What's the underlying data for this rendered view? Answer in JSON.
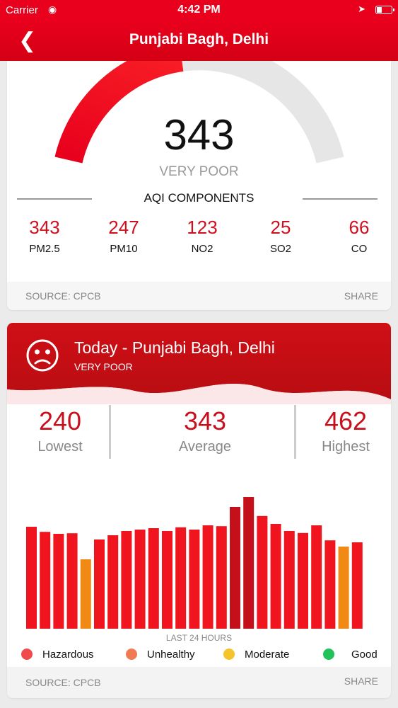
{
  "status_bar": {
    "carrier": "Carrier",
    "time": "4:42 PM"
  },
  "nav": {
    "title": "Punjabi Bagh, Delhi",
    "back_icon": "chevron-left-icon"
  },
  "aqi": {
    "value": "343",
    "status": "VERY POOR",
    "gauge_fill": 0.45
  },
  "components": {
    "title": "AQI COMPONENTS",
    "items": [
      {
        "value": "343",
        "name": "PM2.5"
      },
      {
        "value": "247",
        "name": "PM10"
      },
      {
        "value": "123",
        "name": "NO2"
      },
      {
        "value": "25",
        "name": "SO2"
      },
      {
        "value": "66",
        "name": "CO"
      }
    ]
  },
  "card1_footer": {
    "source": "SOURCE: CPCB",
    "share": "SHARE"
  },
  "today": {
    "title": "Today - Punjabi Bagh, Delhi",
    "status": "VERY POOR",
    "icon": "sad-face-icon",
    "lowest": {
      "value": "240",
      "label": "Lowest"
    },
    "average": {
      "value": "343",
      "label": "Average"
    },
    "highest": {
      "value": "462",
      "label": "Highest"
    }
  },
  "chart_data": {
    "type": "bar",
    "caption": "LAST 24 HOURS",
    "values": [
      360,
      342,
      335,
      337,
      245,
      315,
      330,
      345,
      350,
      355,
      345,
      358,
      350,
      365,
      362,
      430,
      465,
      398,
      370,
      345,
      338,
      365,
      312,
      290,
      305
    ],
    "colors": [
      "#f0141e",
      "#f0141e",
      "#f0141e",
      "#f0141e",
      "#f08a14",
      "#f0141e",
      "#f0141e",
      "#f0141e",
      "#f0141e",
      "#f0141e",
      "#f0141e",
      "#f0141e",
      "#f0141e",
      "#f0141e",
      "#f0141e",
      "#c4101a",
      "#c4101a",
      "#f0141e",
      "#f0141e",
      "#f0141e",
      "#f0141e",
      "#f0141e",
      "#f0141e",
      "#f08a14",
      "#f0141e"
    ],
    "ylim": [
      0,
      470
    ]
  },
  "legend": [
    {
      "label": "Hazardous",
      "color": "#ef4b4b"
    },
    {
      "label": "Unhealthy",
      "color": "#f07a54"
    },
    {
      "label": "Moderate",
      "color": "#f5c42c"
    },
    {
      "label": "Good",
      "color": "#22c25a"
    }
  ],
  "card2_footer": {
    "source": "SOURCE: CPCB",
    "share": "SHARE"
  },
  "colors": {
    "brand_red": "#e8001c",
    "gauge_track": "#e6e6e6"
  }
}
